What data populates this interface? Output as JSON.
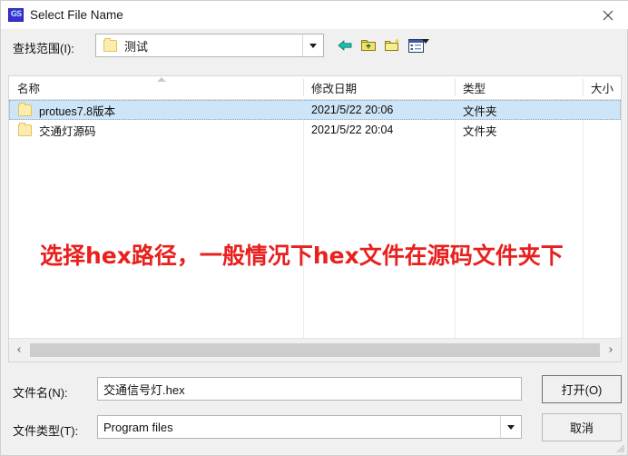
{
  "window": {
    "title": "Select File Name",
    "app_icon": "app-icon",
    "close_icon": "close-icon"
  },
  "toolbar": {
    "lookin_label": "查找范围(I):",
    "lookin_value": "测试",
    "lookin_dropdown_icon": "chevron-down-icon",
    "buttons": [
      {
        "name": "back-button",
        "icon": "back-arrow-icon"
      },
      {
        "name": "up-one-level-button",
        "icon": "up-folder-icon"
      },
      {
        "name": "new-folder-button",
        "icon": "new-folder-icon"
      },
      {
        "name": "views-button",
        "icon": "views-grid-icon"
      }
    ],
    "views_dropdown_icon": "chevron-down-icon"
  },
  "file_list": {
    "columns": [
      {
        "label": "名称",
        "sort": "ascending"
      },
      {
        "label": "修改日期",
        "sort": ""
      },
      {
        "label": "类型",
        "sort": ""
      },
      {
        "label": "大小",
        "sort": ""
      }
    ],
    "rows": [
      {
        "name": "protues7.8版本",
        "date": "2021/5/22 20:06",
        "type": "文件夹",
        "size": "",
        "icon": "folder-icon",
        "selected": true
      },
      {
        "name": "交通灯源码",
        "date": "2021/5/22 20:04",
        "type": "文件夹",
        "size": "",
        "icon": "folder-icon",
        "selected": false
      }
    ],
    "scrollbar": {
      "left_arrow": "‹",
      "right_arrow": "›"
    }
  },
  "annotation": {
    "text": "选择hex路径，一般情况下hex文件在源码文件夹下",
    "color": "#e8201e"
  },
  "footer": {
    "filename_label": "文件名(N):",
    "filename_value": "交通信号灯.hex",
    "filetype_label": "文件类型(T):",
    "filetype_value": "Program files",
    "filetype_dropdown_icon": "chevron-down-icon",
    "open_button": "打开(O)",
    "cancel_button": "取消"
  },
  "colors": {
    "selection": "#cde5f7",
    "dialog_bg": "#f0f0f0",
    "titlebar_bg": "#ffffff",
    "annotation_red": "#e8201e",
    "folder_yellow": "#fdecb0"
  }
}
